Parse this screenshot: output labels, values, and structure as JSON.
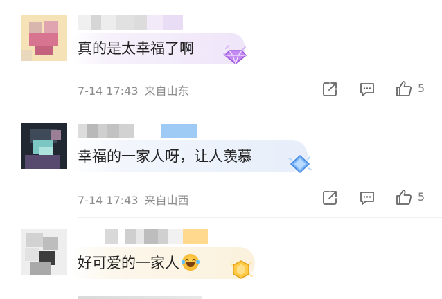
{
  "comments": [
    {
      "text": "真的是太幸福了啊",
      "time": "7-14 17:43",
      "location": "来自山东",
      "likes": "5",
      "badge_icon": "purple-diamond-badge-icon"
    },
    {
      "text": "幸福的一家人呀，让人羡慕",
      "time": "7-14 17:43",
      "location": "来自山西",
      "likes": "5",
      "badge_icon": "blue-diamond-badge-icon"
    },
    {
      "text": "好可爱的一家人",
      "emoji_icon": "laughing-tears-emoji-icon",
      "badge_icon": "gold-hexagon-badge-icon"
    }
  ],
  "icons": {
    "share": "share-icon",
    "comment": "comment-icon",
    "like": "thumbs-up-icon"
  },
  "colors": {
    "text": "#222222",
    "meta": "#8c8c8c",
    "bubble": "#efe5f9",
    "action": "#7c7c7c"
  }
}
